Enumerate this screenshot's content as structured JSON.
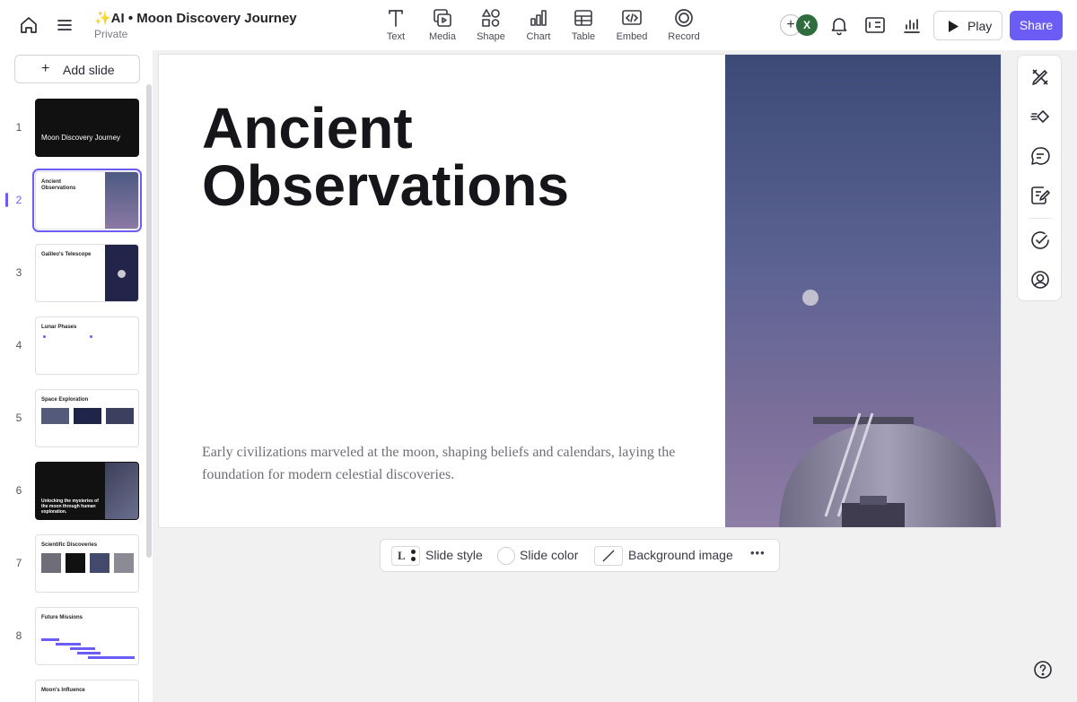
{
  "header": {
    "doc_title": "✨AI • Moon Discovery Journey",
    "doc_subtitle": "Private",
    "tools": [
      {
        "label": "Text",
        "icon": "text-icon"
      },
      {
        "label": "Media",
        "icon": "media-icon"
      },
      {
        "label": "Shape",
        "icon": "shape-icon"
      },
      {
        "label": "Chart",
        "icon": "chart-icon"
      },
      {
        "label": "Table",
        "icon": "table-icon"
      },
      {
        "label": "Embed",
        "icon": "embed-icon"
      },
      {
        "label": "Record",
        "icon": "record-icon"
      }
    ],
    "avatar_initial": "X",
    "play_label": "Play",
    "share_label": "Share"
  },
  "sidebar": {
    "add_slide_label": "Add slide",
    "active_slide": 2,
    "slides": [
      {
        "num": "1",
        "title": "Moon Discovery Journey"
      },
      {
        "num": "2",
        "title": "Ancient Observations"
      },
      {
        "num": "3",
        "title": "Galileo's Telescope"
      },
      {
        "num": "4",
        "title": "Lunar Phases"
      },
      {
        "num": "5",
        "title": "Space Exploration"
      },
      {
        "num": "6",
        "title": "Unlocking the mysteries of the moon through human exploration."
      },
      {
        "num": "7",
        "title": "Scientific Discoveries"
      },
      {
        "num": "8",
        "title": "Future Missions"
      },
      {
        "num": "",
        "title": "Moon's Influence"
      }
    ]
  },
  "slide": {
    "title_line1": "Ancient",
    "title_line2": "Observations",
    "body": "Early civilizations marveled at the moon, shaping beliefs and calendars, laying the foundation for modern celestial discoveries."
  },
  "bottom_toolbar": {
    "style_label": "Slide style",
    "color_label": "Slide color",
    "background_label": "Background image",
    "more_label": "•••"
  },
  "colors": {
    "accent": "#6b5cf5",
    "avatar": "#2f6d3e"
  }
}
